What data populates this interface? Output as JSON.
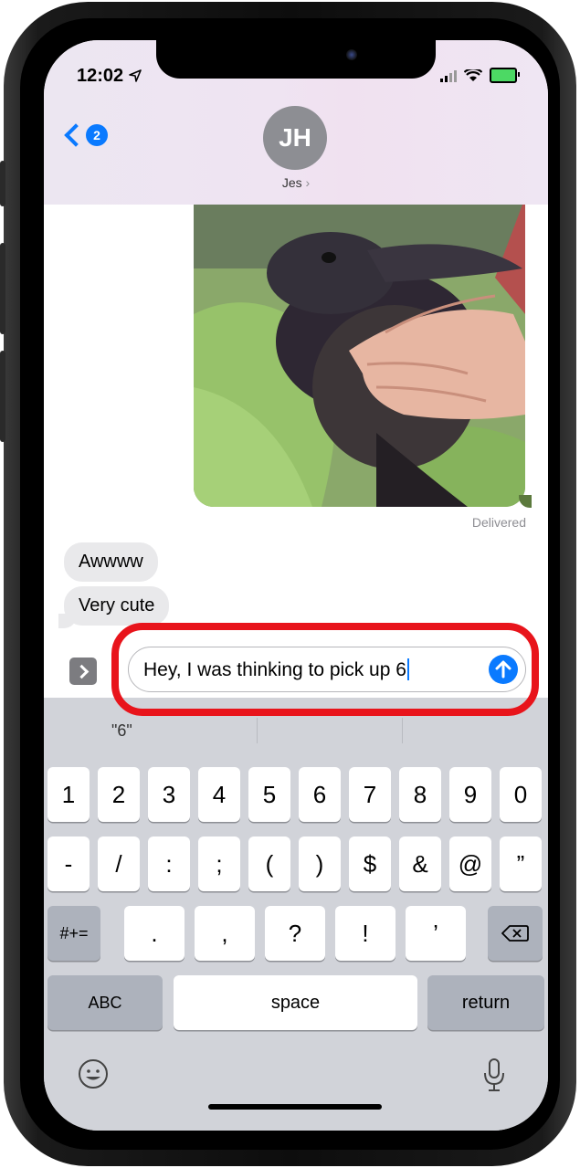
{
  "status_bar": {
    "time": "12:02"
  },
  "header": {
    "back_badge": "2",
    "avatar_initials": "JH",
    "contact_name": "Jes"
  },
  "conversation": {
    "delivered_label": "Delivered",
    "messages": [
      {
        "text": "Awwww"
      },
      {
        "text": "Very cute"
      }
    ]
  },
  "composer": {
    "text": "Hey, I was thinking to pick up 6"
  },
  "keyboard": {
    "prediction": "\"6\"",
    "row1": [
      "1",
      "2",
      "3",
      "4",
      "5",
      "6",
      "7",
      "8",
      "9",
      "0"
    ],
    "row2": [
      "-",
      "/",
      ":",
      ";",
      "(",
      ")",
      "$",
      "&",
      "@",
      "”"
    ],
    "row3_left": "#+=",
    "row3": [
      ".",
      ",",
      "?",
      "!",
      "’"
    ],
    "abc_label": "ABC",
    "space_label": "space",
    "return_label": "return"
  },
  "colors": {
    "accent": "#0a7aff",
    "highlight": "#e8141b",
    "bubble_gray": "#e9e9eb",
    "keyboard_bg": "#d1d3d9"
  }
}
